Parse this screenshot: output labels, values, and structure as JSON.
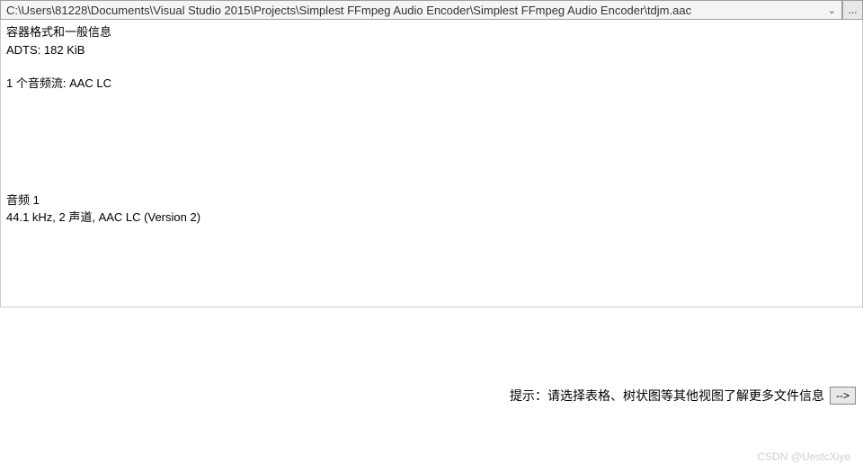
{
  "topbar": {
    "path": "C:\\Users\\81228\\Documents\\Visual Studio 2015\\Projects\\Simplest FFmpeg Audio Encoder\\Simplest FFmpeg Audio Encoder\\tdjm.aac",
    "browse_label": "..."
  },
  "info": {
    "general_header": "容器格式和一般信息",
    "general_line1": "ADTS: 182 KiB",
    "general_line2": "1 个音频流: AAC LC",
    "audio_header": "音频 1",
    "audio_line1": "44.1 kHz, 2 声道, AAC LC (Version 2)"
  },
  "hint": {
    "text": "提示：请选择表格、树状图等其他视图了解更多文件信息",
    "arrow": "-->"
  },
  "watermark": "CSDN @UestcXiye"
}
